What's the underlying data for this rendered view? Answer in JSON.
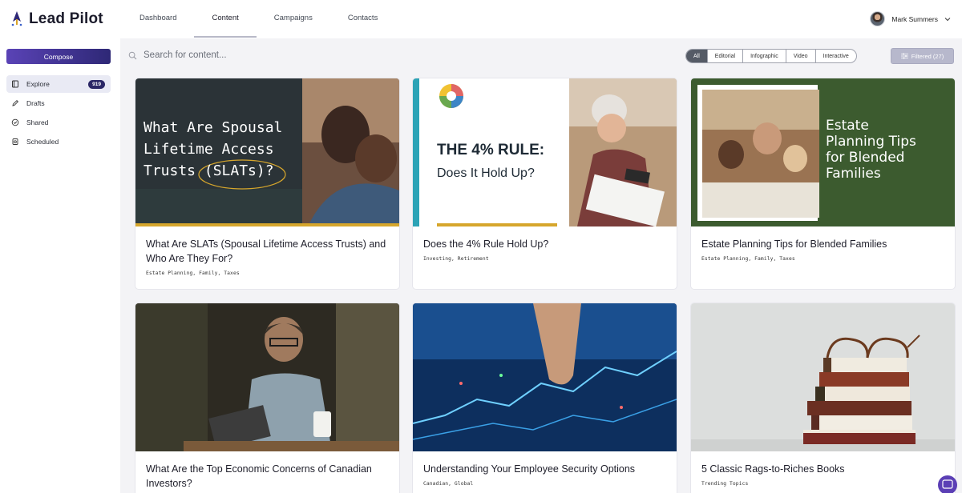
{
  "app": {
    "name": "Lead Pilot"
  },
  "nav": {
    "tabs": [
      "Dashboard",
      "Content",
      "Campaigns",
      "Contacts"
    ],
    "active": "Content"
  },
  "user": {
    "name": "Mark Summers"
  },
  "sidebar": {
    "compose_label": "Compose",
    "items": [
      {
        "label": "Explore",
        "badge": "919",
        "icon": "explore-icon"
      },
      {
        "label": "Drafts",
        "icon": "pencil-icon"
      },
      {
        "label": "Shared",
        "icon": "shared-icon"
      },
      {
        "label": "Scheduled",
        "icon": "scheduled-icon"
      }
    ]
  },
  "search": {
    "placeholder": "Search for content..."
  },
  "filters": {
    "chips": [
      "All",
      "Editorial",
      "Infographic",
      "Video",
      "Interactive"
    ],
    "active": "All"
  },
  "filtered_button": {
    "label": "Filtered (27)"
  },
  "cards": [
    {
      "title": "What Are SLATs (Spousal Lifetime Access Trusts) and Who Are They For?",
      "tags": "Estate Planning, Family, Taxes",
      "image_text": [
        "What Are Spousal",
        "Lifetime Access",
        "Trusts (SLATs)?"
      ]
    },
    {
      "title": "Does the 4% Rule Hold Up?",
      "tags": "Investing, Retirement",
      "image_text": [
        "THE 4% RULE:",
        "Does It Hold Up?"
      ]
    },
    {
      "title": "Estate Planning Tips for Blended Families",
      "tags": "Estate Planning, Family, Taxes",
      "image_text": [
        "Estate",
        "Planning Tips",
        "for Blended",
        "Families"
      ]
    },
    {
      "title": "What Are the Top Economic Concerns of Canadian Investors?",
      "tags": ""
    },
    {
      "title": "Understanding Your Employee Security Options",
      "tags": "Canadian, Global"
    },
    {
      "title": "5 Classic Rags-to-Riches Books",
      "tags": "Trending Topics"
    }
  ],
  "colors": {
    "accent": "#5a43b6",
    "brand_dark": "#2b2766",
    "filter_active": "#555b66",
    "estate_green": "#3c5b2f"
  }
}
